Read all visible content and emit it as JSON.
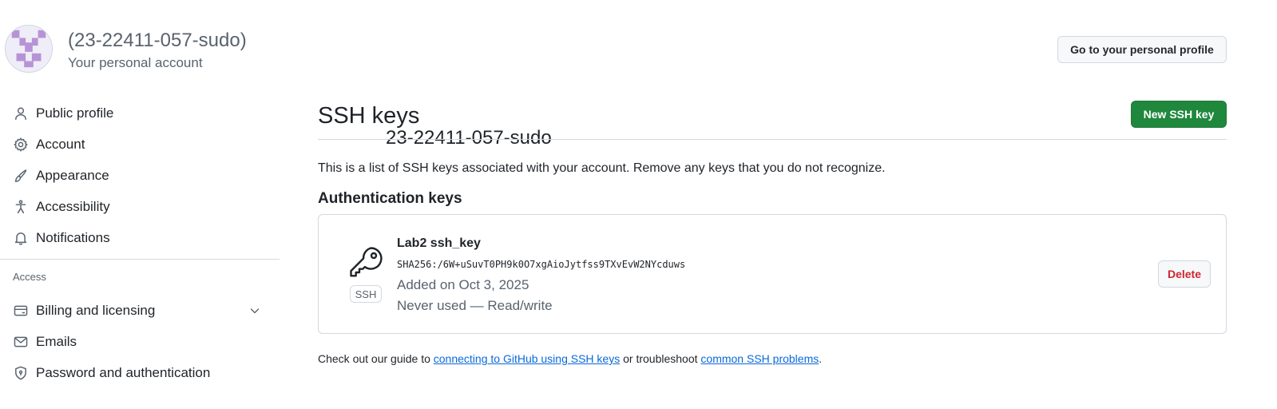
{
  "header": {
    "account_name": "23-22411-057-sudo",
    "account_login": "(23-22411-057-sudo)",
    "account_subtitle": "Your personal account",
    "profile_button": "Go to your personal profile"
  },
  "sidebar": {
    "items": [
      {
        "label": "Public profile",
        "icon": "person-icon"
      },
      {
        "label": "Account",
        "icon": "gear-icon"
      },
      {
        "label": "Appearance",
        "icon": "paintbrush-icon"
      },
      {
        "label": "Accessibility",
        "icon": "accessibility-icon"
      },
      {
        "label": "Notifications",
        "icon": "bell-icon"
      }
    ],
    "access_heading": "Access",
    "access_items": [
      {
        "label": "Billing and licensing",
        "icon": "credit-card-icon"
      },
      {
        "label": "Emails",
        "icon": "mail-icon"
      },
      {
        "label": "Password and authentication",
        "icon": "shield-lock-icon"
      }
    ]
  },
  "main": {
    "title": "SSH keys",
    "new_key_button": "New SSH key",
    "description": "This is a list of SSH keys associated with your account. Remove any keys that you do not recognize.",
    "auth_heading": "Authentication keys",
    "keys": [
      {
        "title": "Lab2 ssh_key",
        "fingerprint": "SHA256:/6W+uSuvT0PH9k0O7xgAioJytfss9TXvEvW2NYcduws",
        "added": "Added on Oct 3, 2025",
        "usage": "Never used — Read/write",
        "badge": "SSH",
        "delete_label": "Delete"
      }
    ],
    "footer": {
      "prefix": "Check out our guide to ",
      "link1": "connecting to GitHub using SSH keys",
      "middle": " or troubleshoot ",
      "link2": "common SSH problems",
      "suffix": "."
    }
  },
  "colors": {
    "primary_green": "#1f883d",
    "danger_red": "#d1242f",
    "link_blue": "#0969da",
    "muted_text": "#59636e",
    "border": "#d1d9e0"
  }
}
